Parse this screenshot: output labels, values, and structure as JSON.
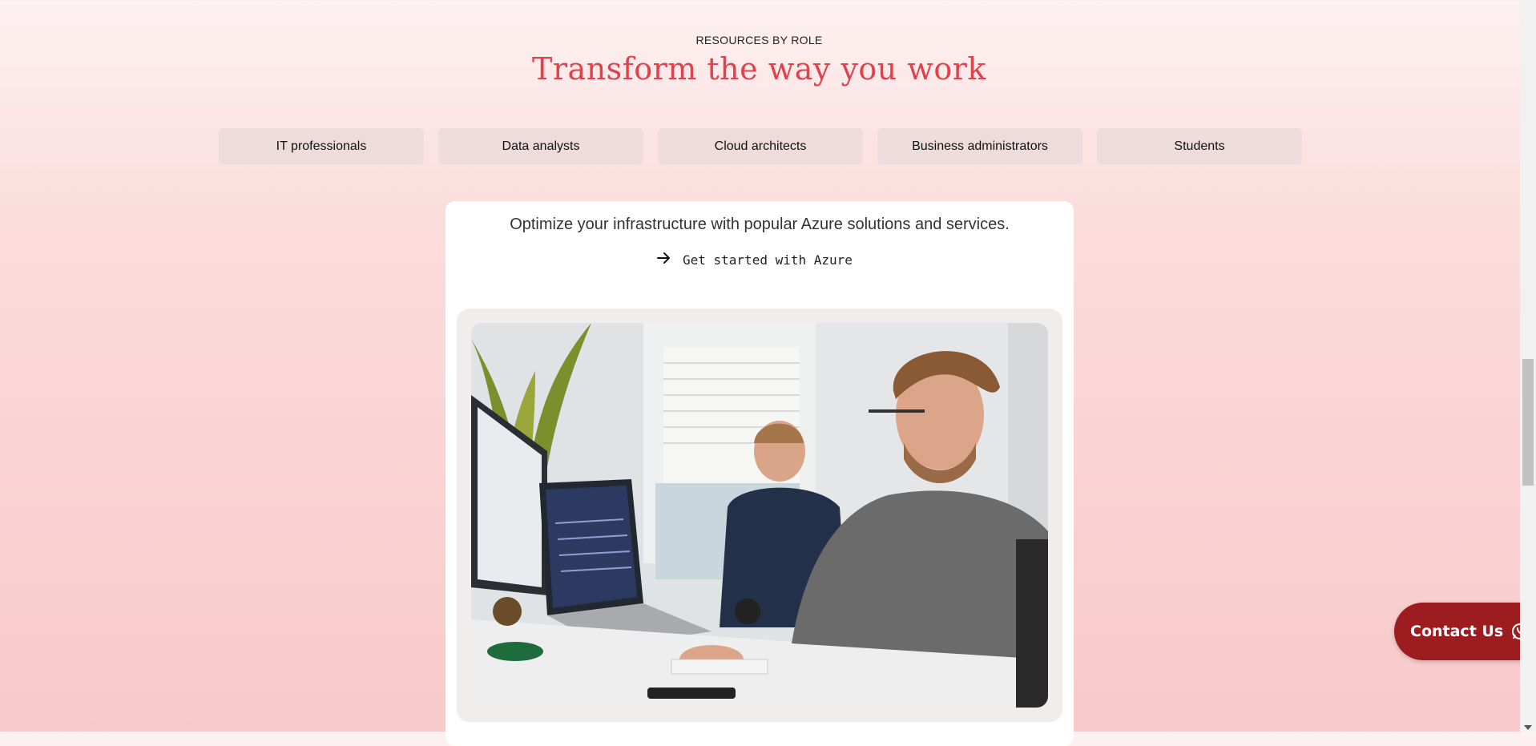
{
  "section": {
    "eyebrow": "RESOURCES BY ROLE",
    "title": "Transform the way you work"
  },
  "tabs": [
    {
      "label": "IT professionals"
    },
    {
      "label": "Data analysts"
    },
    {
      "label": "Cloud architects"
    },
    {
      "label": "Business administrators"
    },
    {
      "label": "Students"
    }
  ],
  "card": {
    "description": "Optimize your infrastructure with popular Azure solutions and services.",
    "cta_label": "Get started with Azure",
    "cta_icon": "arrow-right-icon",
    "image_icon": "office-workers-photo"
  },
  "contact": {
    "label": "Contact Us",
    "icon": "whatsapp-icon"
  },
  "colors": {
    "title": "#e0414a",
    "tab_bg": "#eedcdd",
    "contact_bg": "#9c1c20"
  }
}
